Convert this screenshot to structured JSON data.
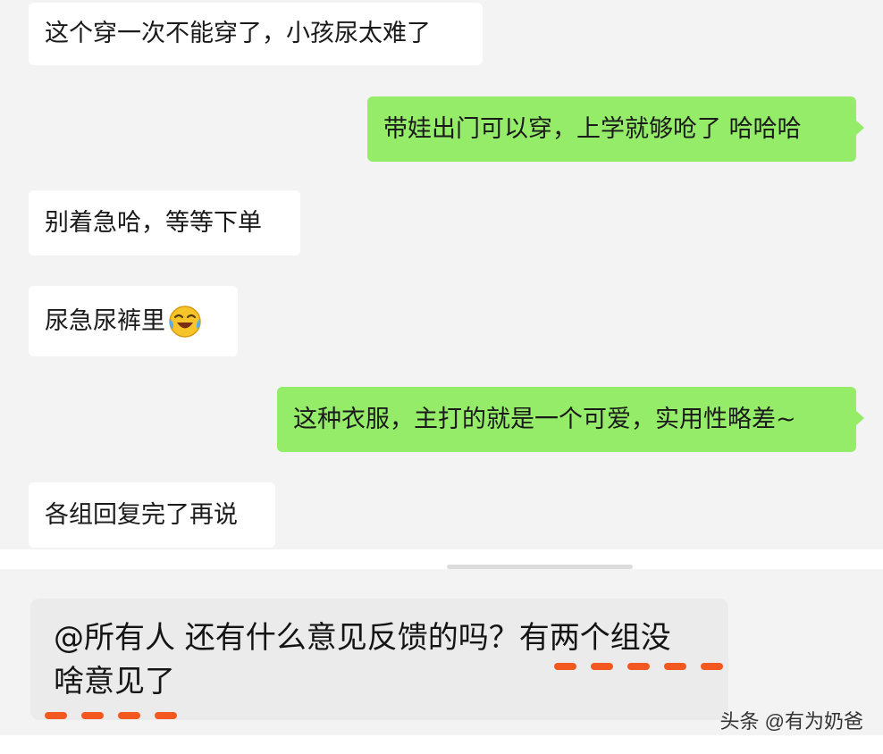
{
  "messages": [
    {
      "side": "left",
      "text": "这个穿一次不能穿了，小孩尿太难了"
    },
    {
      "side": "right",
      "text": "带娃出门可以穿，上学就够呛了 哈哈哈"
    },
    {
      "side": "left",
      "text": "别着急哈，等等下单"
    },
    {
      "side": "left",
      "text": "尿急尿裤里",
      "emoji": "laughing-crying-emoji"
    },
    {
      "side": "right",
      "text": "这种衣服，主打的就是一个可爱，实用性略差~"
    },
    {
      "side": "left",
      "text": "各组回复完了再说"
    }
  ],
  "quoted_message": {
    "line1": "@所有人 还有什么意见反馈的吗？有两个组没",
    "line2": "啥意见了"
  },
  "watermark": "头条 @有为奶爸",
  "colors": {
    "background": "#f3f3f3",
    "incoming_bubble": "#ffffff",
    "outgoing_bubble": "#95ec69",
    "highlight_dash": "#f2581f",
    "quote_bubble": "#ebebeb"
  }
}
